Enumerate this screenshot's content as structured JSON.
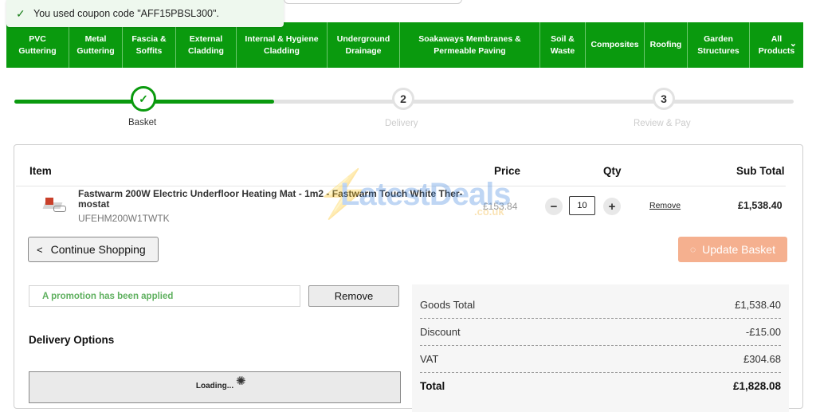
{
  "toast": {
    "message": "You used coupon code \"AFF15PBSL300\"."
  },
  "nav": {
    "items": [
      {
        "label": "PVC\nGuttering"
      },
      {
        "label": "Metal\nGuttering"
      },
      {
        "label": "Fascia &\nSoffits"
      },
      {
        "label": "External\nCladding"
      },
      {
        "label": "Internal & Hygiene\nCladding"
      },
      {
        "label": "Underground\nDrainage"
      },
      {
        "label": "Soakaways Membranes &\nPermeable Paving"
      },
      {
        "label": "Soil &\nWaste"
      },
      {
        "label": "Composites"
      },
      {
        "label": "Roofing"
      },
      {
        "label": "Garden\nStructures"
      },
      {
        "label": "All\nProducts"
      }
    ]
  },
  "steps": [
    {
      "number": "",
      "label": "Basket",
      "state": "done"
    },
    {
      "number": "2",
      "label": "Delivery",
      "state": "pending"
    },
    {
      "number": "3",
      "label": "Review & Pay",
      "state": "pending"
    }
  ],
  "basket": {
    "headers": {
      "item": "Item",
      "price": "Price",
      "qty": "Qty",
      "subtotal": "Sub Total"
    },
    "product": {
      "name": "Fastwarm 200W Electric Underfloor Heating Mat - 1m2 - Fastwarm Touch White Ther-mostat",
      "sku": "UFEHM200W1TWTK",
      "price": "£153.84",
      "qty": "10",
      "remove_label": "Remove",
      "line_total": "£1,538.40"
    },
    "continue_label": "Continue Shopping",
    "update_label": "Update Basket"
  },
  "watermark": {
    "text": "LatestDeals",
    "domain": ".co.uk"
  },
  "promo": {
    "message": "A promotion has been applied",
    "remove_label": "Remove"
  },
  "delivery": {
    "title": "Delivery Options",
    "loading_text": "Loading..."
  },
  "summary": {
    "goods_label": "Goods Total",
    "goods_value": "£1,538.40",
    "discount_label": "Discount",
    "discount_value": "-£15.00",
    "vat_label": "VAT",
    "vat_value": "£304.68",
    "total_label": "Total",
    "total_value": "£1,828.08"
  },
  "colors": {
    "brand_green": "#0a9a0e",
    "update_button": "#f5b08f",
    "promo_text": "#5fb05f"
  }
}
